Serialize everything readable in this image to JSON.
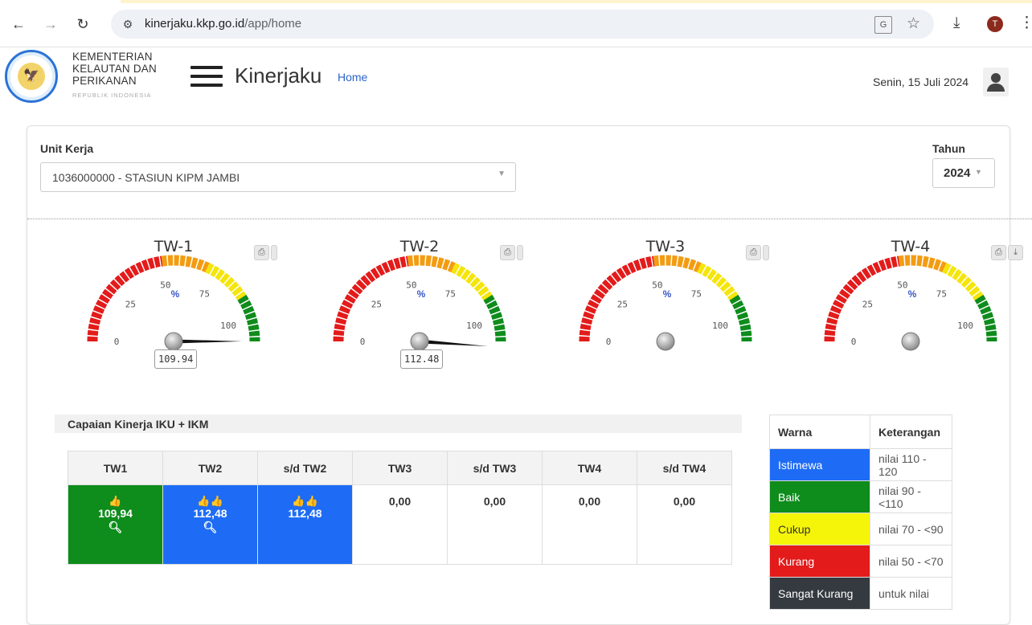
{
  "browser": {
    "url_host": "kinerjaku.kkp.go.id",
    "url_path": "/app/home",
    "profile_initial": "T"
  },
  "header": {
    "org_line1": "KEMENTERIAN",
    "org_line2": "KELAUTAN DAN",
    "org_line3": "PERIKANAN",
    "org_sub": "REPUBLIK INDONESIA",
    "app_title": "Kinerjaku",
    "breadcrumb": "Home",
    "date": "Senin, 15 Juli 2024"
  },
  "filters": {
    "unit_label": "Unit Kerja",
    "unit_value": "1036000000 - STASIUN KIPM JAMBI",
    "year_label": "Tahun",
    "year_value": "2024"
  },
  "gauges": [
    {
      "title": "TW-1",
      "value": 109.94,
      "value_label": "109.94"
    },
    {
      "title": "TW-2",
      "value": 112.48,
      "value_label": "112.48"
    },
    {
      "title": "TW-3",
      "value": null,
      "value_label": ""
    },
    {
      "title": "TW-4",
      "value": null,
      "value_label": ""
    }
  ],
  "gauge_scale": {
    "ticks": [
      "0",
      "25",
      "50",
      "75",
      "100"
    ],
    "unit": "%",
    "bands": [
      {
        "from": 0,
        "to": 50,
        "color": "#e31b1b"
      },
      {
        "from": 50,
        "to": 70,
        "color": "#f39c12"
      },
      {
        "from": 70,
        "to": 90,
        "color": "#f5e50a"
      },
      {
        "from": 90,
        "to": 110,
        "color": "#0e8c1c"
      }
    ]
  },
  "capaian": {
    "title": "Capaian Kinerja IKU + IKM",
    "headers": [
      "TW1",
      "TW2",
      "s/d TW2",
      "TW3",
      "s/d TW3",
      "TW4",
      "s/d TW4"
    ],
    "cells": [
      {
        "value": "109,94",
        "icons": "👍",
        "color": "green",
        "search": true
      },
      {
        "value": "112,48",
        "icons": "👍👍",
        "color": "blue",
        "search": true
      },
      {
        "value": "112,48",
        "icons": "👍👍",
        "color": "blue",
        "search": false
      },
      {
        "value": "0,00",
        "icons": "",
        "color": "none",
        "search": false
      },
      {
        "value": "0,00",
        "icons": "",
        "color": "none",
        "search": false
      },
      {
        "value": "0,00",
        "icons": "",
        "color": "none",
        "search": false
      },
      {
        "value": "0,00",
        "icons": "",
        "color": "none",
        "search": false
      }
    ]
  },
  "legend": {
    "header_warna": "Warna",
    "header_keterangan": "Keterangan",
    "rows": [
      {
        "label": "Istimewa",
        "desc": "nilai 110 - 120",
        "color": "#1e6cf5",
        "text_color": "#ffffff"
      },
      {
        "label": "Baik",
        "desc": "nilai 90 - <110",
        "color": "#0e8c1c",
        "text_color": "#ffffff"
      },
      {
        "label": "Cukup",
        "desc": "nilai 70 - <90",
        "color": "#f5f50a",
        "text_color": "#333333"
      },
      {
        "label": "Kurang",
        "desc": "nilai 50 - <70",
        "color": "#e31b1b",
        "text_color": "#ffffff"
      },
      {
        "label": "Sangat Kurang",
        "desc": "untuk nilai",
        "color": "#343a40",
        "text_color": "#ffffff"
      }
    ]
  }
}
